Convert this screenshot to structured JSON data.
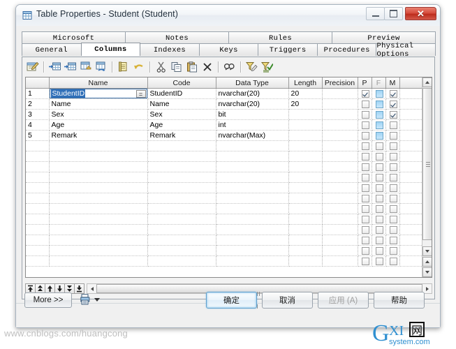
{
  "window": {
    "title": "Table Properties - Student (Student)",
    "icon": "table-icon",
    "minimize_label": "Minimize",
    "maximize_label": "Maximize",
    "close_label": "Close"
  },
  "tabs": {
    "top_row": [
      {
        "label": "Microsoft",
        "active": false
      },
      {
        "label": "Notes",
        "active": false
      },
      {
        "label": "Rules",
        "active": false
      },
      {
        "label": "Preview",
        "active": false
      }
    ],
    "bottom_row": [
      {
        "label": "General",
        "active": false
      },
      {
        "label": "Columns",
        "active": true
      },
      {
        "label": "Indexes",
        "active": false
      },
      {
        "label": "Keys",
        "active": false
      },
      {
        "label": "Triggers",
        "active": false
      },
      {
        "label": "Procedures",
        "active": false
      },
      {
        "label": "Physical Options",
        "active": false
      }
    ]
  },
  "toolbar": {
    "buttons": [
      {
        "name": "properties-icon",
        "title": "Properties"
      },
      {
        "name": "insert-row-icon",
        "title": "Insert a Row"
      },
      {
        "name": "add-row-icon",
        "title": "Add a Row"
      },
      {
        "name": "add-column-icon",
        "title": "Add Column"
      },
      {
        "name": "replace-column-icon",
        "title": "Replace Column"
      },
      {
        "name": "new-note-icon",
        "title": "New"
      },
      {
        "name": "undo-icon",
        "title": "Undo"
      },
      {
        "name": "cut-icon",
        "title": "Cut"
      },
      {
        "name": "copy-icon",
        "title": "Copy"
      },
      {
        "name": "paste-icon",
        "title": "Paste"
      },
      {
        "name": "delete-icon",
        "title": "Delete"
      },
      {
        "name": "find-icon",
        "title": "Find"
      },
      {
        "name": "filter-icon",
        "title": "Customize Columns and Filter"
      },
      {
        "name": "apply-filter-icon",
        "title": "Apply Filter"
      }
    ]
  },
  "grid": {
    "columns": [
      {
        "key": "num",
        "label": ""
      },
      {
        "key": "name",
        "label": "Name"
      },
      {
        "key": "code",
        "label": "Code"
      },
      {
        "key": "datatype",
        "label": "Data Type"
      },
      {
        "key": "length",
        "label": "Length"
      },
      {
        "key": "precision",
        "label": "Precision"
      },
      {
        "key": "p",
        "label": "P"
      },
      {
        "key": "f",
        "label": "F"
      },
      {
        "key": "m",
        "label": "M"
      },
      {
        "key": "spacer",
        "label": ""
      }
    ],
    "rows": [
      {
        "num": "1",
        "name": "StudentID",
        "code": "StudentID",
        "datatype": "nvarchar(20)",
        "length": "20",
        "precision": "",
        "p": true,
        "f": false,
        "m": true,
        "editing": true
      },
      {
        "num": "2",
        "name": "Name",
        "code": "Name",
        "datatype": "nvarchar(20)",
        "length": "20",
        "precision": "",
        "p": false,
        "f": false,
        "m": true,
        "editing": false
      },
      {
        "num": "3",
        "name": "Sex",
        "code": "Sex",
        "datatype": "bit",
        "length": "",
        "precision": "",
        "p": false,
        "f": false,
        "m": true,
        "editing": false
      },
      {
        "num": "4",
        "name": "Age",
        "code": "Age",
        "datatype": "int",
        "length": "",
        "precision": "",
        "p": false,
        "f": false,
        "m": false,
        "editing": false
      },
      {
        "num": "5",
        "name": "Remark",
        "code": "Remark",
        "datatype": "nvarchar(Max)",
        "length": "",
        "precision": "",
        "p": false,
        "f": false,
        "m": false,
        "editing": false
      }
    ],
    "empty_row_count": 12,
    "editing_cell": {
      "text": "StudentID",
      "ellipsis_label": "="
    }
  },
  "nav_buttons": [
    {
      "name": "move-to-top-button",
      "glyph": "⤒"
    },
    {
      "name": "move-up-fast-button",
      "glyph": "⇈"
    },
    {
      "name": "move-up-button",
      "glyph": "↑"
    },
    {
      "name": "move-down-button",
      "glyph": "↓"
    },
    {
      "name": "move-down-fast-button",
      "glyph": "⇊"
    },
    {
      "name": "move-to-bottom-button",
      "glyph": "⤓"
    }
  ],
  "footer": {
    "more_label": "More >>",
    "ok_label": "确定",
    "cancel_label": "取消",
    "apply_label": "应用 (A)",
    "help_label": "帮助",
    "apply_disabled": true,
    "print_icon": "print-icon"
  },
  "watermarks": {
    "url_text": "www.cnblogs.com/huangcong",
    "logo_main": "GXI",
    "logo_cjk": "网",
    "logo_sub": "system.com"
  },
  "colors": {
    "accent_blue": "#2f6fb8",
    "checkbox_blue": "#9fd4f5",
    "close_red": "#d4483a",
    "watermark_gray": "#bfbfbf",
    "logo_blue": "#2f8fd0"
  }
}
